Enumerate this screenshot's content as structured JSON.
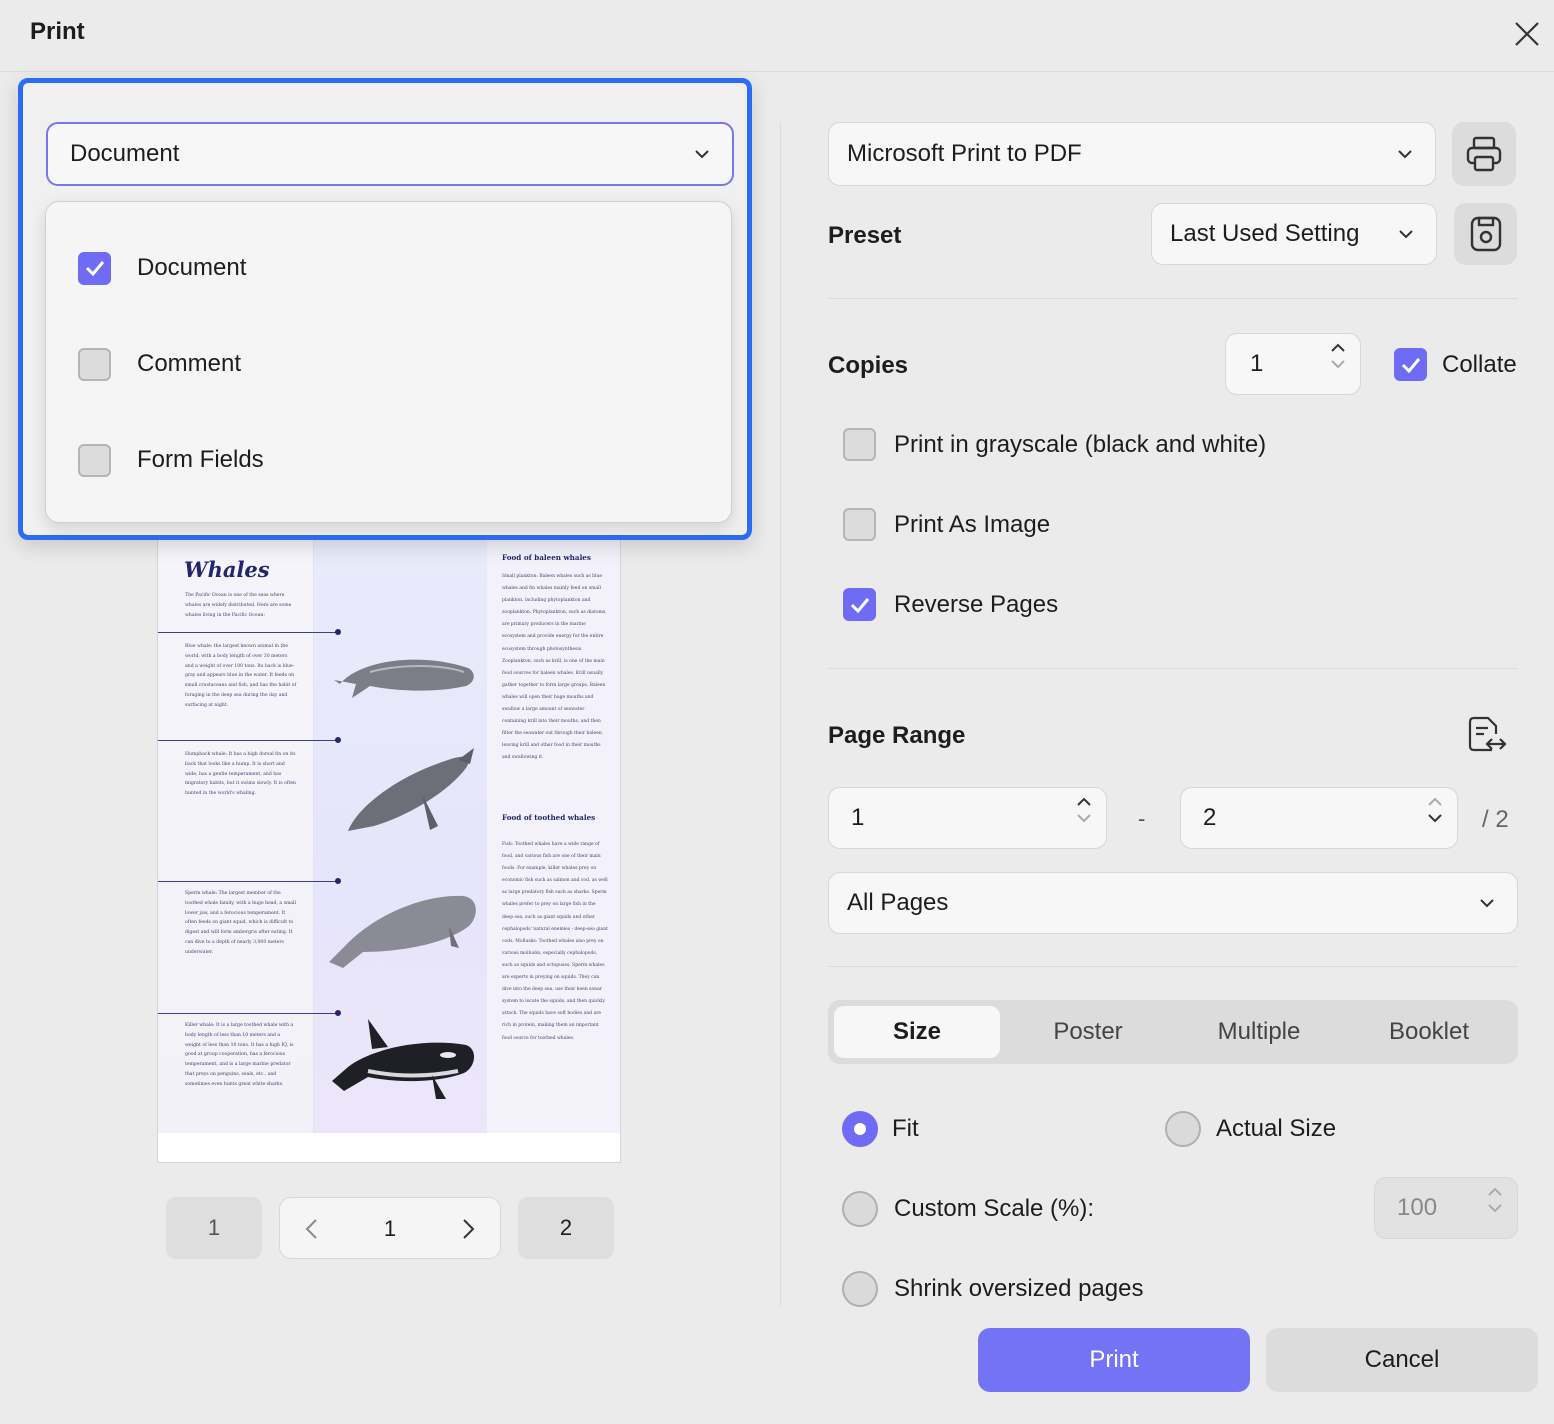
{
  "window": {
    "title": "Print"
  },
  "content_select": {
    "value": "Document",
    "options": [
      {
        "label": "Document",
        "checked": true
      },
      {
        "label": "Comment",
        "checked": false
      },
      {
        "label": "Form Fields",
        "checked": false
      }
    ]
  },
  "printer": {
    "value": "Microsoft Print to PDF"
  },
  "preset": {
    "label": "Preset",
    "value": "Last Used Setting"
  },
  "copies": {
    "label": "Copies",
    "value": "1",
    "collate_label": "Collate",
    "collate_checked": true
  },
  "options": [
    {
      "label": "Print in grayscale (black and white)",
      "checked": false
    },
    {
      "label": "Print As Image",
      "checked": false
    },
    {
      "label": "Reverse Pages",
      "checked": true
    }
  ],
  "page_range": {
    "label": "Page Range",
    "from": "1",
    "dash": "-",
    "to": "2",
    "total": "/ 2",
    "mode": "All Pages"
  },
  "tabs": [
    {
      "label": "Size",
      "active": true
    },
    {
      "label": "Poster",
      "active": false
    },
    {
      "label": "Multiple",
      "active": false
    },
    {
      "label": "Booklet",
      "active": false
    }
  ],
  "size_options": {
    "fit": "Fit",
    "actual": "Actual Size",
    "custom": "Custom Scale (%):",
    "custom_value": "100",
    "shrink": "Shrink oversized pages",
    "selected": "Fit"
  },
  "preview_nav": {
    "first": "1",
    "current": "1",
    "last": "2"
  },
  "buttons": {
    "print": "Print",
    "cancel": "Cancel"
  },
  "preview": {
    "title": "Whales",
    "intro": "The Pacific Ocean is one of the seas where whales are widely distributed. Here are some whales living in the Pacific Ocean:",
    "blue": "Blue whale: the largest known animal in the world, with a body length of over 30 meters and a weight of over 100 tons. Its back is blue-gray and appears blue in the water. It feeds on small crustaceans and fish, and has the habit of foraging in the deep sea during the day and surfacing at night.",
    "humpback": "Humpback whale: It has a high dorsal fin on its back that looks like a hump. It is short and wide, has a gentle temperament, and has migratory habits, but it swims slowly. It is often hunted in the world's whaling.",
    "sperm": "Sperm whale: The largest member of the toothed whale family, with a huge head, a small lower jaw, and a ferocious temperament. It often feeds on giant squid, which is difficult to digest and will form ambergris after eating. It can dive to a depth of nearly 3,000 meters underwater.",
    "killer": "Killer whale: It is a large toothed whale with a body length of less than 10 meters and a weight of less than 10 tons. It has a high IQ, is good at group cooperation, has a ferocious temperament, and is a large marine predator that preys on penguins, seals, etc., and sometimes even hunts great white sharks.",
    "baleen_head": "Food of baleen whales",
    "baleen_text": "Small plankton: Baleen whales such as blue whales and fin whales mainly feed on small plankton, including phytoplankton and zooplankton. Phytoplankton, such as diatoms, are primary producers in the marine ecosystem and provide energy for the entire ecosystem through photosynthesis. Zooplankton, such as krill, is one of the main food sources for baleen whales. Krill usually gather together to form large groups. Baleen whales will open their huge mouths and swallow a large amount of seawater containing krill into their mouths, and then filter the seawater out through their baleen, leaving krill and other food in their mouths and swallowing it.",
    "toothed_head": "Food of toothed whales",
    "toothed_text": "Fish: Toothed whales have a wide range of food, and various fish are one of their main foods. For example, killer whales prey on economic fish such as salmon and cod, as well as large predatory fish such as sharks. Sperm whales prefer to prey on large fish in the deep sea, such as giant squids and other cephalopods' natural enemies - deep-sea giant cods. Mollusks: Toothed whales also prey on various mollusks, especially cephalopods, such as squids and octopuses. Sperm whales are experts in preying on squids. They can dive into the deep sea, use their keen sonar system to locate the squids, and then quickly attack. The squids have soft bodies and are rich in protein, making them an important food source for toothed whales."
  },
  "colors": {
    "accent": "#6f6bf4",
    "highlight": "#2c6cf5",
    "print_button": "#7473f5"
  },
  "icons": [
    "close-icon",
    "chevron-down-icon",
    "printer-icon",
    "save-icon",
    "checkmark-icon",
    "chevron-up-icon",
    "page-range-swap-icon",
    "chevron-left-icon",
    "chevron-right-icon"
  ]
}
